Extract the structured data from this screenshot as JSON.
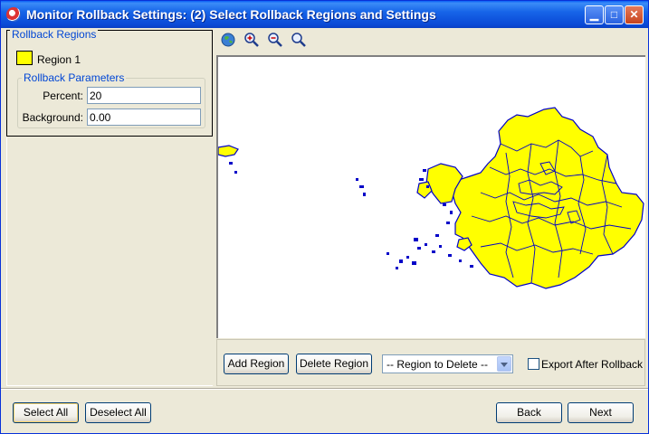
{
  "window": {
    "title": "Monitor Rollback Settings:  (2) Select Rollback Regions and Settings"
  },
  "left": {
    "group_title": "Rollback Regions",
    "region": {
      "label": "Region 1",
      "color": "#ffff00"
    },
    "params": {
      "title": "Rollback Parameters",
      "percent_label": "Percent:",
      "percent_value": "20",
      "background_label": "Background:",
      "background_value": "0.00"
    }
  },
  "toolbar": {
    "icons": [
      "globe-icon",
      "zoom-in-icon",
      "zoom-out-icon",
      "zoom-icon"
    ]
  },
  "map": {
    "fill": "#ffff00",
    "stroke": "#0000c8"
  },
  "map_controls": {
    "add_region": "Add Region",
    "delete_region": "Delete Region",
    "region_to_delete": "-- Region to Delete --",
    "export_label": "Export After Rollback",
    "export_checked": false
  },
  "footer": {
    "select_all": "Select All",
    "deselect_all": "Deselect All",
    "back": "Back",
    "next": "Next"
  }
}
